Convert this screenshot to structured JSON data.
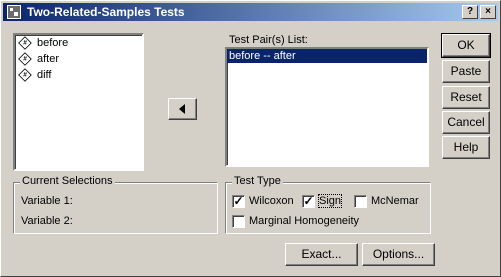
{
  "window": {
    "title": "Two-Related-Samples Tests"
  },
  "variables": [
    {
      "label": "before",
      "icon": "numeric-variable-icon"
    },
    {
      "label": "after",
      "icon": "numeric-variable-icon"
    },
    {
      "label": "diff",
      "icon": "numeric-variable-icon"
    }
  ],
  "pairs": {
    "label": "Test Pair(s) List:",
    "items": [
      "before -- after"
    ]
  },
  "current_selections": {
    "title": "Current Selections",
    "var1_label": "Variable 1:",
    "var2_label": "Variable 2:"
  },
  "test_type": {
    "title": "Test Type",
    "wilcoxon": {
      "label": "Wilcoxon",
      "checked": true
    },
    "sign": {
      "label": "Sign",
      "checked": true
    },
    "mcnemar": {
      "label": "McNemar",
      "checked": false
    },
    "marginal": {
      "label": "Marginal Homogeneity",
      "checked": false
    }
  },
  "buttons": {
    "ok": "OK",
    "paste": "Paste",
    "reset": "Reset",
    "cancel": "Cancel",
    "help": "Help",
    "exact": "Exact...",
    "options": "Options..."
  },
  "icons": {
    "move_arrow": "left-arrow-icon",
    "help_title": "?",
    "close_title": "×"
  }
}
